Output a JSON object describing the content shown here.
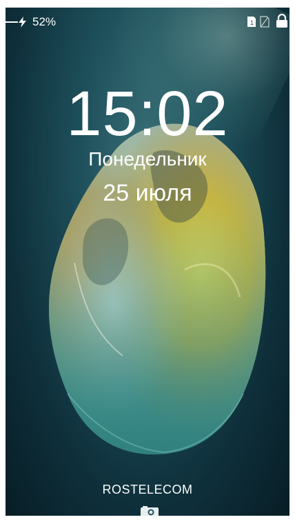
{
  "status_bar": {
    "battery_percent": "52%",
    "icons": [
      "charging-icon",
      "sim1-icon",
      "sim2-icon",
      "lock-icon"
    ]
  },
  "lock_screen": {
    "time": "15:02",
    "weekday": "Понедельник",
    "date": "25 июля",
    "carrier": "ROSTELECOM",
    "camera_icon": "camera-icon"
  },
  "colors": {
    "background_dark": "#0e2f3a",
    "background_teal": "#3a6f77",
    "crystal_yellow": "#e8c432",
    "crystal_orange": "#d78a1f",
    "text": "#ffffff"
  }
}
